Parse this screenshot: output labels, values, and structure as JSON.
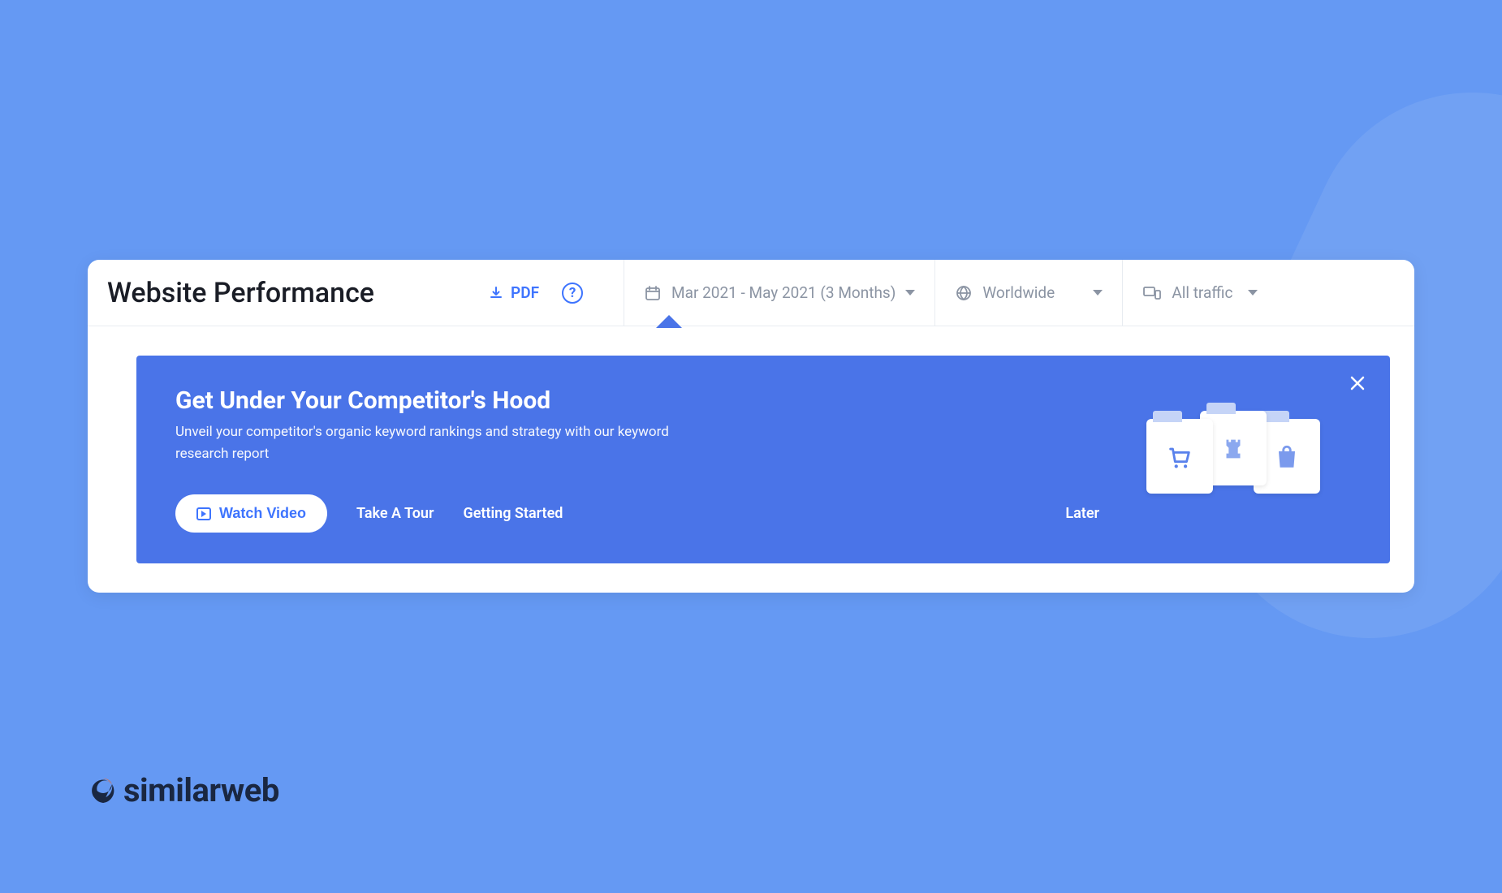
{
  "header": {
    "title": "Website Performance",
    "pdf_label": "PDF",
    "date_range": "Mar 2021 - May 2021 (3 Months)",
    "region": "Worldwide",
    "traffic": "All traffic"
  },
  "banner": {
    "title": "Get Under Your Competitor's Hood",
    "subtitle": "Unveil your competitor's organic keyword rankings and strategy with our keyword research report",
    "watch_video_label": "Watch Video",
    "take_tour_label": "Take A Tour",
    "getting_started_label": "Getting Started",
    "later_label": "Later"
  },
  "brand": {
    "name": "similarweb"
  }
}
